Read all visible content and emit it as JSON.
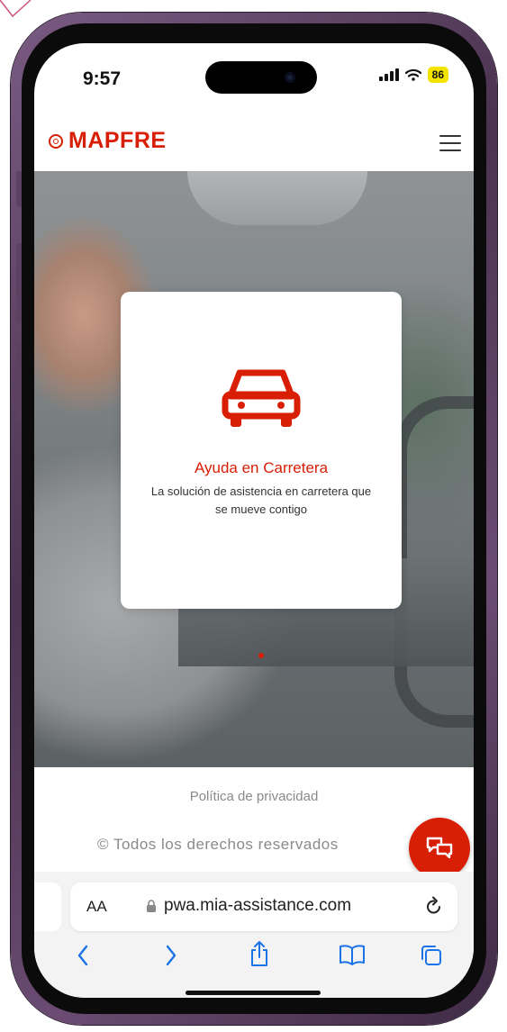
{
  "status": {
    "time": "9:57",
    "battery": "86"
  },
  "header": {
    "logo_text": "MAPFRE",
    "menu_icon": "hamburger-icon"
  },
  "hero": {
    "card": {
      "icon": "car-icon",
      "title": "Ayuda en Carretera",
      "description": "La solución de asistencia en carretera que se mueve contigo"
    },
    "carousel_active_index": 1
  },
  "footer": {
    "privacy_link": "Política de privacidad",
    "copyright": "© Todos los derechos reservados"
  },
  "chat": {
    "icon": "chat-icon"
  },
  "browser": {
    "aa_label": "AA",
    "url": "pwa.mia-assistance.com",
    "toolbar_icons": [
      "back-icon",
      "forward-icon",
      "share-icon",
      "bookmarks-icon",
      "tabs-icon"
    ]
  },
  "colors": {
    "brand": "#d81e05",
    "battery": "#f2e400"
  }
}
